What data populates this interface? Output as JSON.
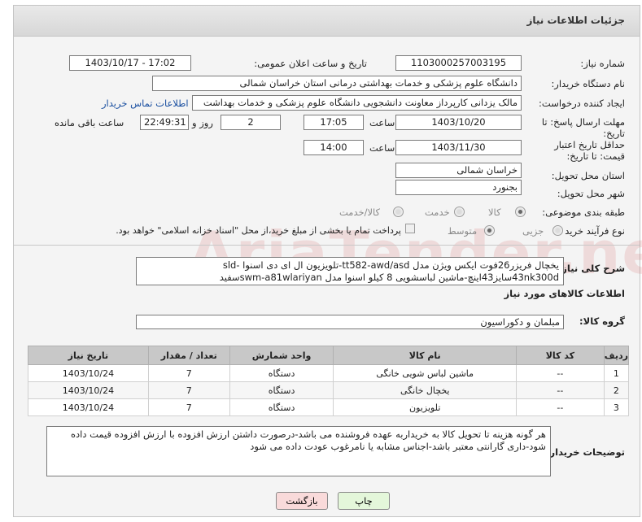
{
  "header": {
    "title": "جزئیات اطلاعات نیاز"
  },
  "fields": {
    "need_number_label": "شماره نیاز:",
    "need_number": "1103000257003195",
    "announce_label": "تاریخ و ساعت اعلان عمومی:",
    "announce_value": "1403/10/17 - 17:02",
    "buyer_org_label": "نام دستگاه خریدار:",
    "buyer_org": "دانشگاه علوم پزشکی و خدمات بهداشتی درمانی استان خراسان شمالی",
    "creator_label": "ایجاد کننده درخواست:",
    "creator": "مالک یزدانی کارپرداز معاونت دانشجویی دانشگاه علوم پزشکی و خدمات بهداشت",
    "contact_link": "اطلاعات تماس خریدار",
    "reply_deadline_label": "مهلت ارسال پاسخ: تا تاریخ:",
    "reply_date": "1403/10/20",
    "time_label": "ساعت",
    "reply_time": "17:05",
    "days_value": "2",
    "days_label": "روز و",
    "remaining_time": "22:49:31",
    "remaining_label": "ساعت باقی مانده",
    "price_validity_label": "حداقل تاریخ اعتبار قیمت: تا تاریخ:",
    "price_date": "1403/11/30",
    "price_time": "14:00",
    "province_label": "استان محل تحویل:",
    "province": "خراسان شمالی",
    "city_label": "شهر محل تحویل:",
    "city": "بجنورد",
    "category_label": "طبقه بندی موضوعی:",
    "category_options": [
      "کالا",
      "خدمت",
      "کالا/خدمت"
    ],
    "process_label": "نوع فرآیند خرید :",
    "process_options": [
      "جزیی",
      "متوسط"
    ],
    "payment_note": "پرداخت تمام یا بخشی از مبلغ خرید،از محل \"اسناد خزانه اسلامی\" خواهد بود."
  },
  "summary": {
    "label": "شرح کلی نیاز:",
    "text": "یخچال فریزر26فوت ایکس ویژن مدل tt582-awd/asd-تلویزیون ال ای دی اسنوا sld-43nk300dسایز43اینچ-ماشین لباسشویی 8 کیلو اسنوا مدل swm-a81wlariyanسفید"
  },
  "goods": {
    "section_title": "اطلاعات کالاهای مورد نیاز",
    "group_label": "گروه کالا:",
    "group_value": "مبلمان و دکوراسیون",
    "columns": [
      "ردیف",
      "کد کالا",
      "نام کالا",
      "واحد شمارش",
      "تعداد / مقدار",
      "تاریخ نیاز"
    ],
    "rows": [
      {
        "index": "1",
        "code": "--",
        "name": "ماشین لباس شویی خانگی",
        "unit": "دستگاه",
        "qty": "7",
        "date": "1403/10/24"
      },
      {
        "index": "2",
        "code": "--",
        "name": "یخچال خانگی",
        "unit": "دستگاه",
        "qty": "7",
        "date": "1403/10/24"
      },
      {
        "index": "3",
        "code": "--",
        "name": "تلویزیون",
        "unit": "دستگاه",
        "qty": "7",
        "date": "1403/10/24"
      }
    ]
  },
  "buyer_notes": {
    "label": "توضیحات خریدار:",
    "text": "هر گونه هزینه تا تحویل کالا به خریداربه عهده فروشنده می باشد-درصورت داشتن ارزش افزوده با ارزش افزوده قیمت داده شود-داری گارانتی معتبر باشد-اجناس مشابه یا نامرغوب عودت داده می شود"
  },
  "buttons": {
    "print": "چاپ",
    "back": "بازگشت"
  },
  "watermark": "AriaTender.neT",
  "colors": {
    "back_button": "#f9dada",
    "print_button": "#e4f7da",
    "table_header": "#c8c8c8"
  }
}
